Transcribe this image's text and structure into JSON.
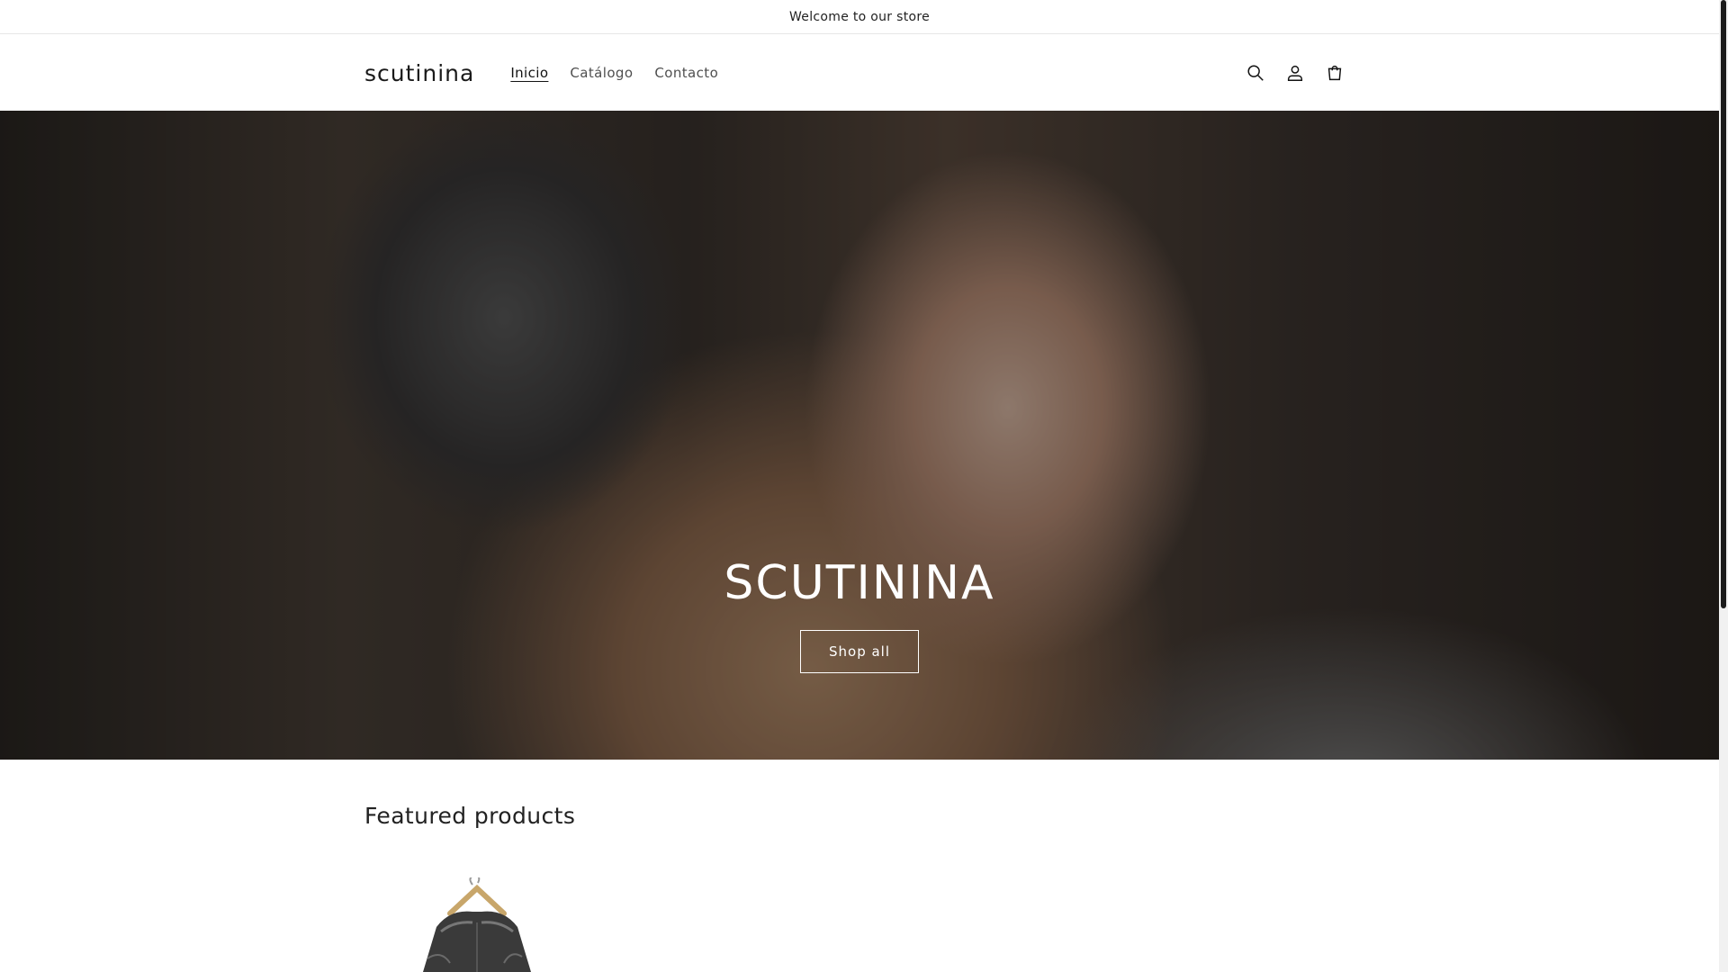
{
  "announcement": {
    "text": "Welcome to our store"
  },
  "header": {
    "logo": "scutinina",
    "nav": [
      {
        "label": "Inicio",
        "active": true
      },
      {
        "label": "Catálogo",
        "active": false
      },
      {
        "label": "Contacto",
        "active": false
      }
    ],
    "icons": [
      "search-icon",
      "account-icon",
      "cart-icon"
    ]
  },
  "hero": {
    "title": "SCUTININA",
    "button_label": "Shop all"
  },
  "featured": {
    "title": "Featured products"
  },
  "colors": {
    "text": "#121212",
    "hero_text": "#ffffff",
    "background": "#ffffff"
  }
}
